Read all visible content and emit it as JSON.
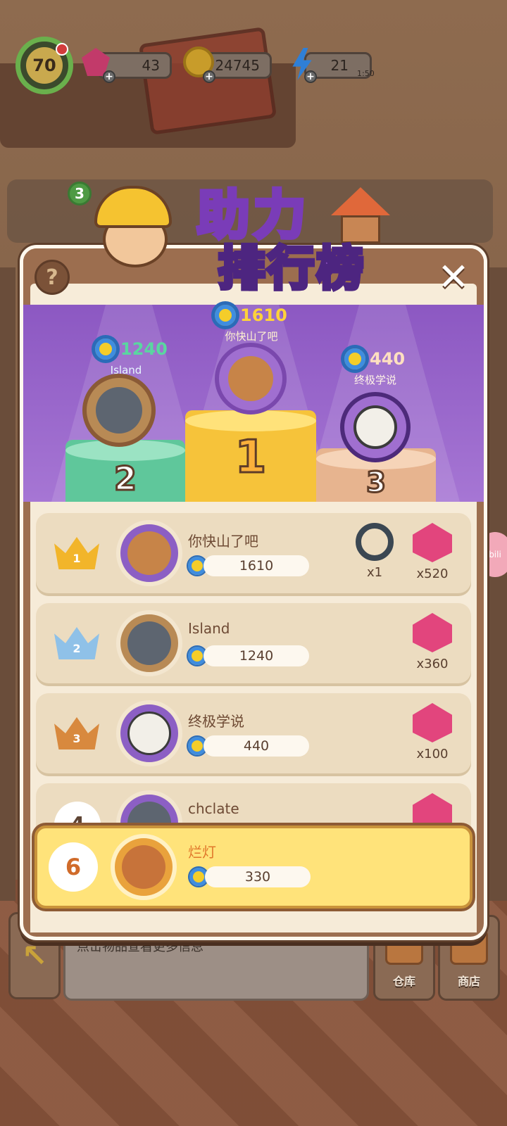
{
  "hud": {
    "level": "70",
    "gems": "43",
    "coins": "24745",
    "energy": "21",
    "energy_timer": "1:50"
  },
  "background": {
    "shelf_badge": "3"
  },
  "modal": {
    "title_line1": "助力",
    "title_line2": "排行榜",
    "help_label": "?",
    "close_label": "✕"
  },
  "podium": [
    {
      "place": "1",
      "name": "你快山了吧",
      "score": "1610",
      "color": "#f6c33a"
    },
    {
      "place": "2",
      "name": "Island",
      "score": "1240",
      "color": "#5fc79b"
    },
    {
      "place": "3",
      "name": "终极学说",
      "score": "440",
      "color": "#e7b48f"
    }
  ],
  "leaderboard": [
    {
      "rank": "1",
      "name": "你快山了吧",
      "score": "1610",
      "rewards": [
        {
          "icon": "guitar-ring-icon",
          "count": "x1"
        },
        {
          "icon": "gem-icon",
          "count": "x520"
        }
      ]
    },
    {
      "rank": "2",
      "name": "Island",
      "score": "1240",
      "rewards": [
        {
          "icon": "gem-icon",
          "count": "x360"
        }
      ]
    },
    {
      "rank": "3",
      "name": "终极学说",
      "score": "440",
      "rewards": [
        {
          "icon": "gem-icon",
          "count": "x100"
        }
      ]
    },
    {
      "rank": "4",
      "name": "chclate",
      "score": "",
      "rewards": [
        {
          "icon": "gem-icon",
          "count": ""
        }
      ]
    }
  ],
  "my_entry": {
    "rank": "6",
    "name": "烂灯",
    "score": "330"
  },
  "bottom_bar": {
    "info_text": "点击物品查看更多信息",
    "warehouse_label": "仓库",
    "shop_label": "商店"
  },
  "colors": {
    "purple_stage": "#9a66cc",
    "gold": "#f6c33a",
    "highlight_row": "#ffe37a"
  }
}
